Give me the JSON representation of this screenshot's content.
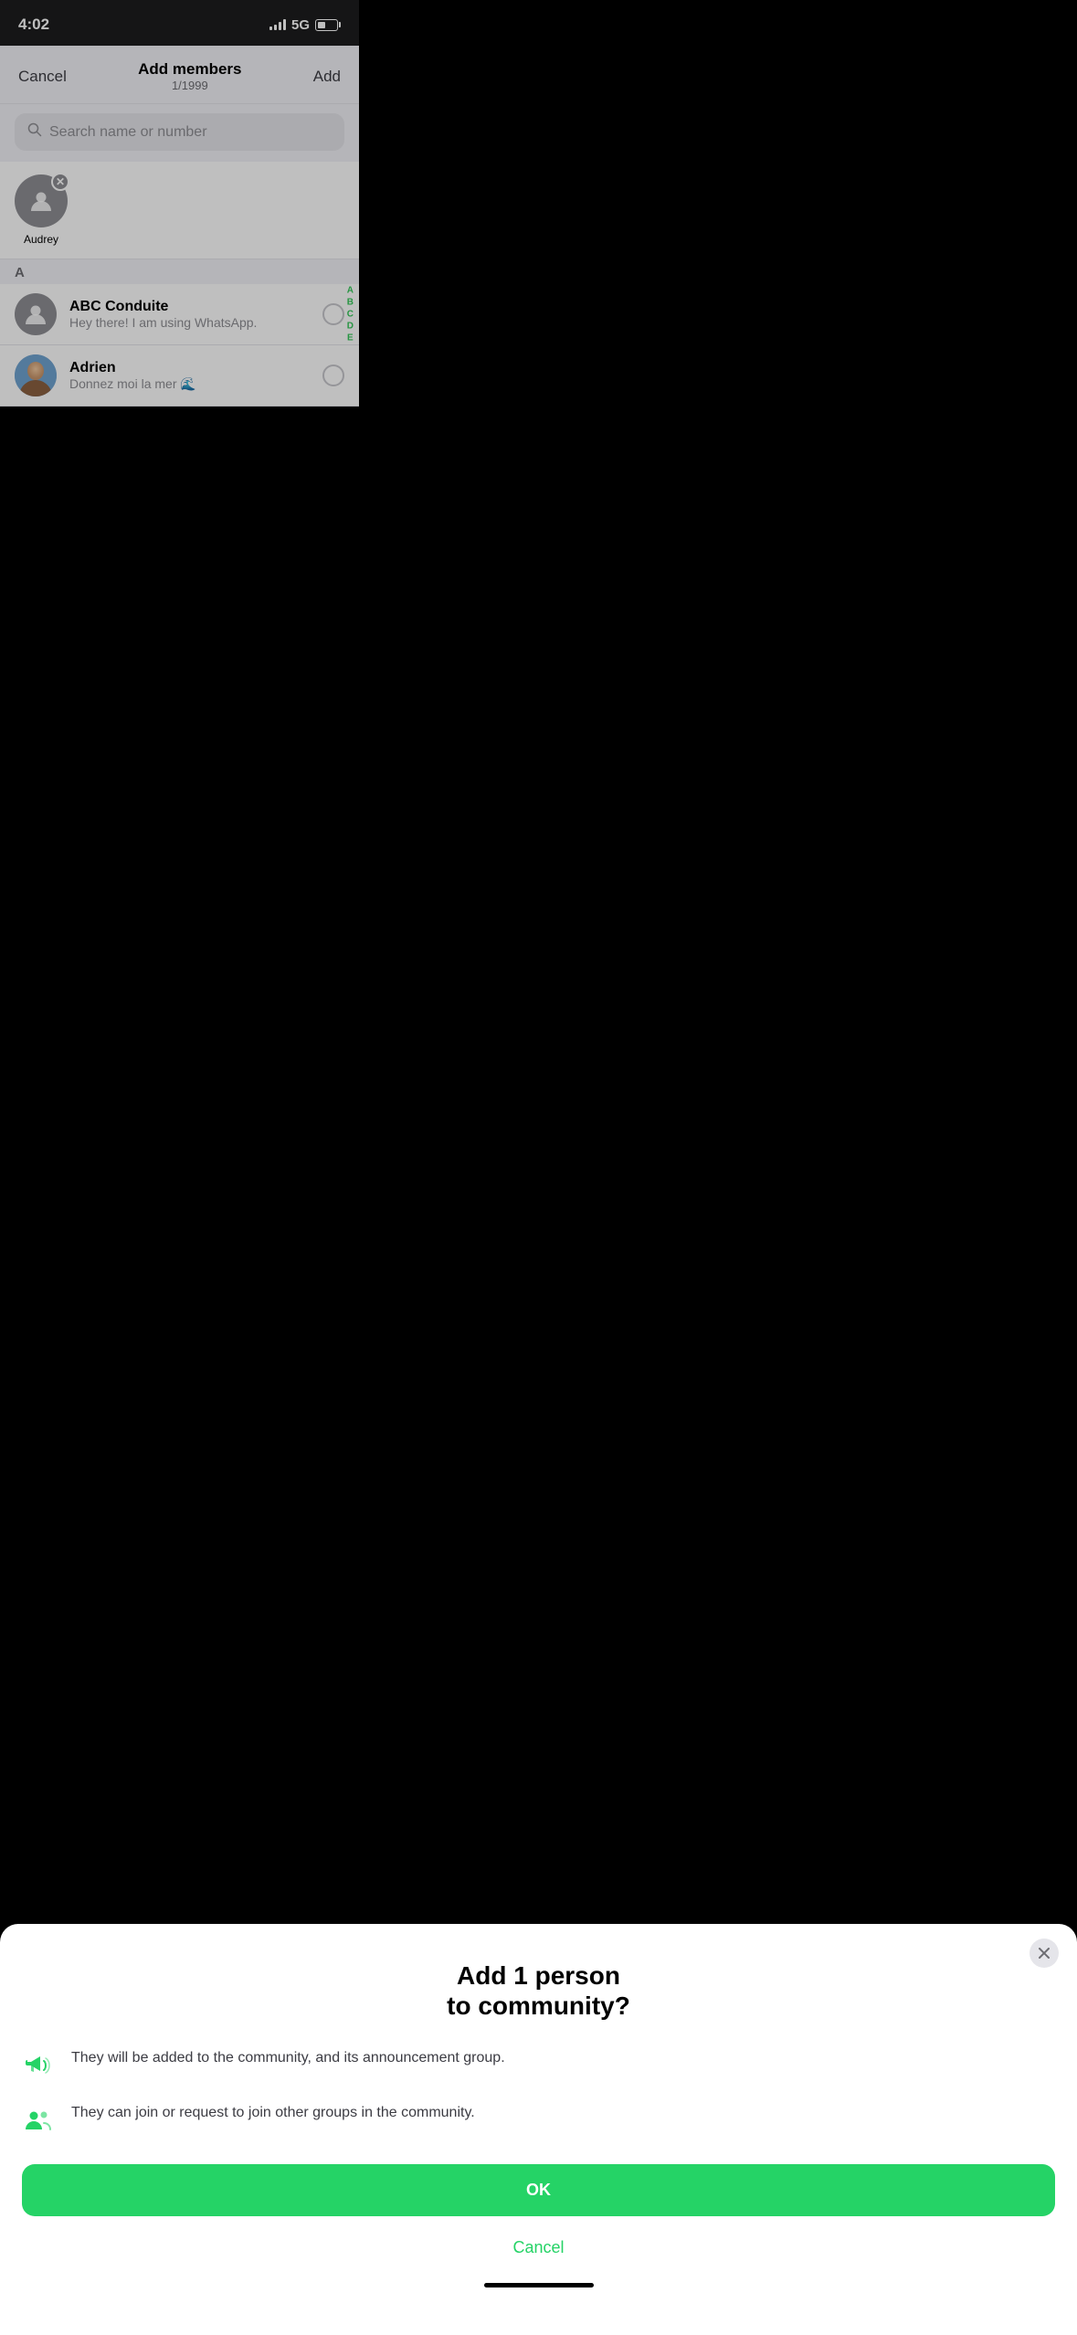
{
  "statusBar": {
    "time": "4:02",
    "network": "5G"
  },
  "header": {
    "cancel_label": "Cancel",
    "title": "Add members",
    "subtitle": "1/1999",
    "add_label": "Add"
  },
  "search": {
    "placeholder": "Search name or number"
  },
  "selectedContacts": [
    {
      "name": "Audrey",
      "hasAvatar": false
    }
  ],
  "sectionLabel": "A",
  "contacts": [
    {
      "name": "ABC Conduite",
      "status": "Hey there! I am using WhatsApp.",
      "hasAvatar": false
    },
    {
      "name": "Adrien",
      "status": "Donnez moi la mer 🌊",
      "hasAvatar": true
    }
  ],
  "alphabetIndex": [
    "A",
    "B",
    "C",
    "D",
    "E"
  ],
  "modal": {
    "title": "Add 1 person\nto community?",
    "info1": "They will be added to the community, and its announcement group.",
    "info2": "They can join or request to join other groups in the community.",
    "ok_label": "OK",
    "cancel_label": "Cancel"
  }
}
